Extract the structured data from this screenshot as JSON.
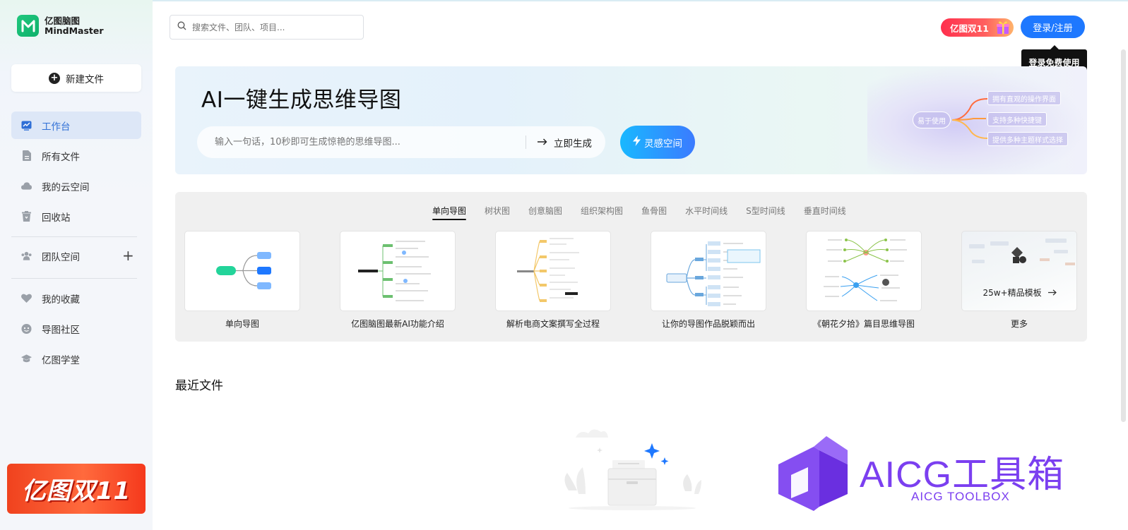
{
  "app": {
    "logo_cn": "亿图脑图",
    "logo_en": "MindMaster"
  },
  "sidebar": {
    "new_file": "新建文件",
    "items": [
      {
        "label": "工作台",
        "icon": "workbench-icon"
      },
      {
        "label": "所有文件",
        "icon": "file-icon"
      },
      {
        "label": "我的云空间",
        "icon": "cloud-icon"
      },
      {
        "label": "回收站",
        "icon": "trash-icon"
      },
      {
        "label": "团队空间",
        "icon": "team-icon"
      },
      {
        "label": "我的收藏",
        "icon": "heart-icon"
      },
      {
        "label": "导图社区",
        "icon": "community-icon"
      },
      {
        "label": "亿图学堂",
        "icon": "academy-icon"
      }
    ],
    "promo": "亿图双11"
  },
  "header": {
    "search_placeholder": "搜索文件、团队、项目...",
    "badge": "亿图双11",
    "login": "登录/注册",
    "tooltip": "登录免费使用"
  },
  "hero": {
    "title": "AI一键生成思维导图",
    "input_placeholder": "输入一句话，10秒即可生成惊艳的思维导图...",
    "generate": "立即生成",
    "inspire": "灵感空间",
    "art_center": "易于使用",
    "art_pills": [
      "拥有直观的操作界面",
      "支持多种快捷键",
      "提供多种主题样式选择"
    ]
  },
  "gallery": {
    "tabs": [
      "单向导图",
      "树状图",
      "创意脑图",
      "组织架构图",
      "鱼骨图",
      "水平时间线",
      "S型时间线",
      "垂直时间线"
    ],
    "cards": [
      {
        "label": "单向导图"
      },
      {
        "label": "亿图脑图最新AI功能介绍"
      },
      {
        "label": "解析电商文案撰写全过程"
      },
      {
        "label": "让你的导图作品脱颖而出"
      },
      {
        "label": "《朝花夕拾》篇目思维导图"
      },
      {
        "label": "更多"
      }
    ],
    "more_text": "25w+精品模板"
  },
  "recent": {
    "title": "最近文件"
  },
  "watermark": {
    "title": "AICG工具箱",
    "subtitle": "AICG TOOLBOX"
  },
  "colors": {
    "accent": "#1e78ff",
    "brand_green": "#20c77d",
    "watermark": "#7b3ff0"
  }
}
